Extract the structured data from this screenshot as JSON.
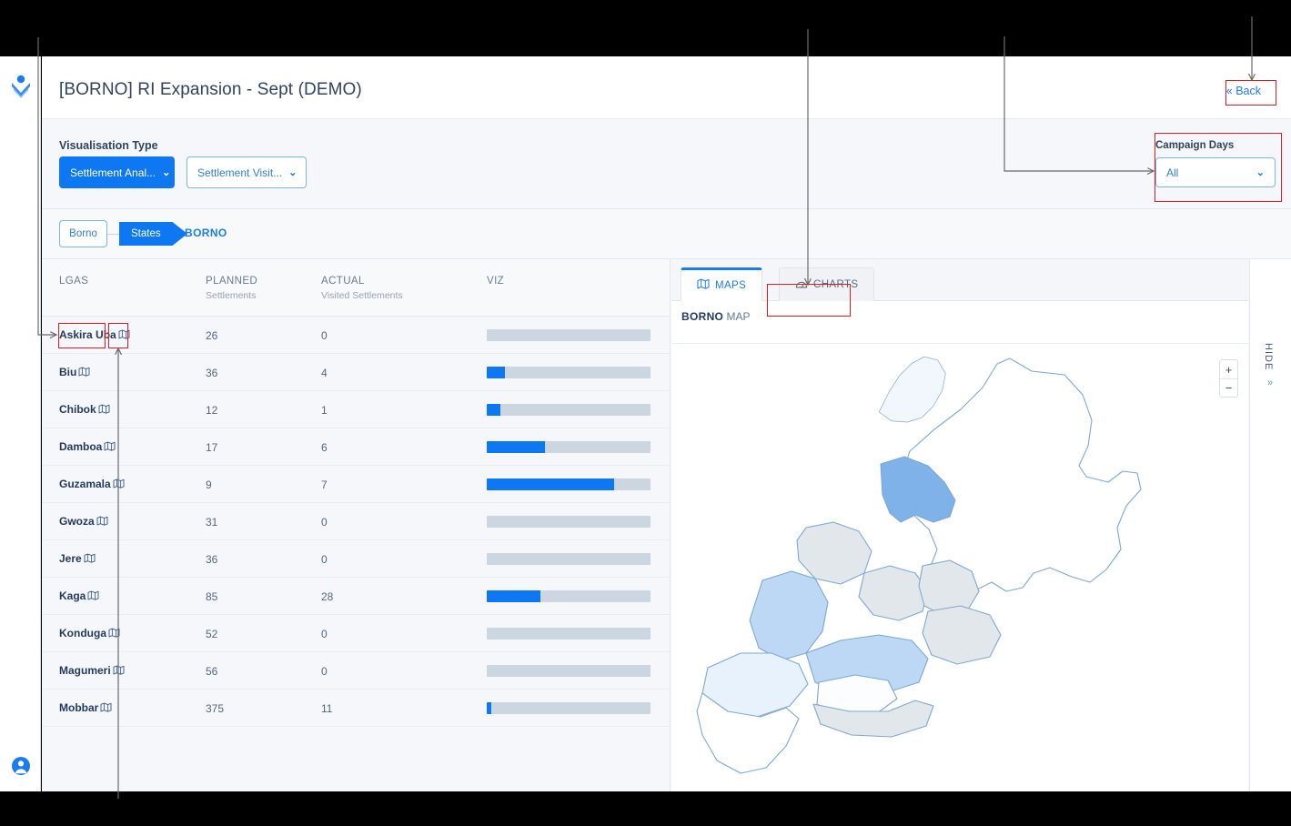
{
  "app": {
    "title": "[BORNO] RI Expansion - Sept (DEMO)",
    "back_label": "« Back"
  },
  "rail": {
    "logo_name": "app-logo-icon",
    "user_name": "user-account-icon"
  },
  "controls": {
    "viz_type_label": "Visualisation Type",
    "primary_select": {
      "value": "Settlement Anal...",
      "chevron": "⌄"
    },
    "secondary_select": {
      "value": "Settlement Visit...",
      "chevron": "⌄"
    },
    "campaign": {
      "label": "Campaign Days",
      "value": "All",
      "chevron": "⌄"
    }
  },
  "breadcrumb": {
    "chip": "Borno",
    "level": "States",
    "current": "BORNO"
  },
  "table": {
    "headers": {
      "lga": "LGAS",
      "planned": "PLANNED",
      "planned_sub": "Settlements",
      "actual": "ACTUAL",
      "actual_sub": "Visited Settlements",
      "viz": "VIZ"
    },
    "rows": [
      {
        "lga": "Askira Uba",
        "planned": "26",
        "actual": "0",
        "pct": 0
      },
      {
        "lga": "Biu",
        "planned": "36",
        "actual": "4",
        "pct": 11.1
      },
      {
        "lga": "Chibok",
        "planned": "12",
        "actual": "1",
        "pct": 8.3
      },
      {
        "lga": "Damboa",
        "planned": "17",
        "actual": "6",
        "pct": 35.3
      },
      {
        "lga": "Guzamala",
        "planned": "9",
        "actual": "7",
        "pct": 77.8
      },
      {
        "lga": "Gwoza",
        "planned": "31",
        "actual": "0",
        "pct": 0
      },
      {
        "lga": "Jere",
        "planned": "36",
        "actual": "0",
        "pct": 0
      },
      {
        "lga": "Kaga",
        "planned": "85",
        "actual": "28",
        "pct": 32.9
      },
      {
        "lga": "Konduga",
        "planned": "52",
        "actual": "0",
        "pct": 0
      },
      {
        "lga": "Magumeri",
        "planned": "56",
        "actual": "0",
        "pct": 0
      },
      {
        "lga": "Mobbar",
        "planned": "375",
        "actual": "11",
        "pct": 2.9
      }
    ]
  },
  "right_panel": {
    "tabs": [
      {
        "label": "MAPS",
        "icon": "map-icon",
        "active": true
      },
      {
        "label": "CHARTS",
        "icon": "chart-icon",
        "active": false
      }
    ],
    "caption_bold": "BORNO",
    "caption_rest": " MAP",
    "zoom_in": "+",
    "zoom_out": "−"
  },
  "hide_rail": {
    "label": "HIDE",
    "chevron": "»"
  },
  "colors": {
    "accent_blue": "#0d78f2",
    "link_blue": "#1b7ced",
    "bar_track": "#ccd6e0",
    "annotation_red": "#e11b22",
    "page_bg": "#f4f6f9",
    "title_navy": "#243a5e"
  }
}
